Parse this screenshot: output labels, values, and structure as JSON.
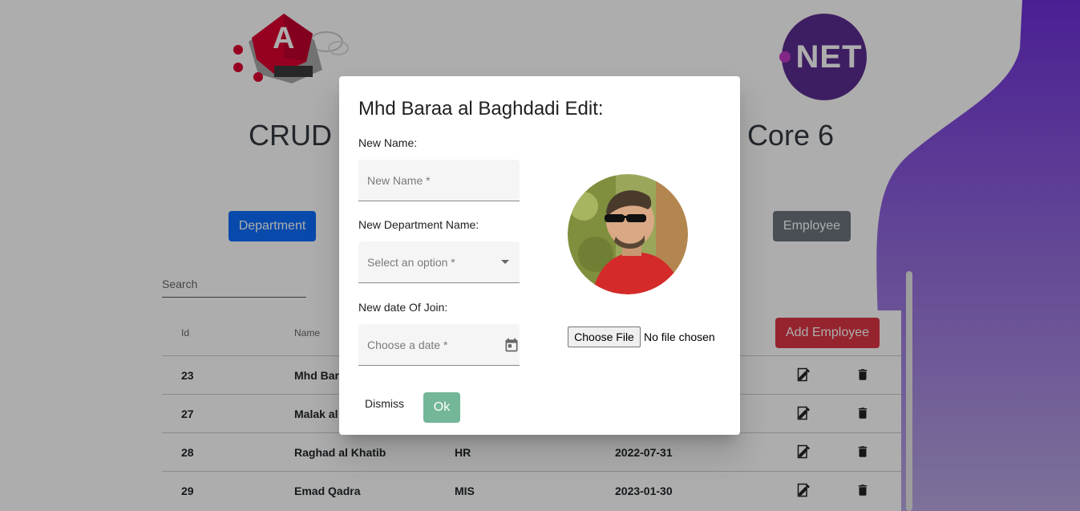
{
  "page": {
    "title_left": "CRUD F",
    "title_right": "Core 6",
    "department_button": "Department",
    "employee_button": "Employee",
    "add_employee_button": "Add Employee",
    "search_placeholder": "Search",
    "net_logo_text": "NET"
  },
  "table": {
    "headers": [
      "Id",
      "Name"
    ],
    "rows": [
      {
        "id": "23",
        "name": "Mhd Bar",
        "department": "",
        "date": ""
      },
      {
        "id": "27",
        "name": "Malak al",
        "department": "",
        "date": ""
      },
      {
        "id": "28",
        "name": "Raghad al Khatib",
        "department": "HR",
        "date": "2022-07-31"
      },
      {
        "id": "29",
        "name": "Emad Qadra",
        "department": "MIS",
        "date": "2023-01-30"
      }
    ]
  },
  "dialog": {
    "title": "Mhd Baraa al Baghdadi Edit:",
    "name_label": "New Name:",
    "name_placeholder": "New Name *",
    "department_label": "New Department Name:",
    "department_placeholder": "Select an option *",
    "date_label": "New date Of Join:",
    "date_placeholder": "Choose a date *",
    "file_button": "Choose File",
    "file_status": "No file chosen",
    "dismiss_button": "Dismiss",
    "ok_button": "Ok"
  },
  "colors": {
    "primary": "#0d6efd",
    "secondary": "#6c757d",
    "danger": "#dc3545",
    "success": "#198754",
    "net_purple": "#5c2d91",
    "blob_purple": "#6a3fb5"
  }
}
